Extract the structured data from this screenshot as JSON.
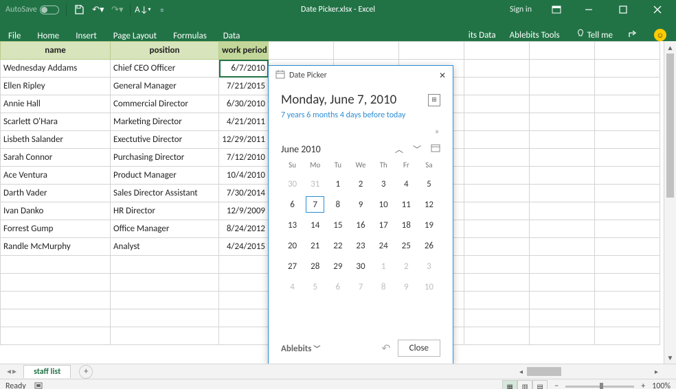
{
  "titlebar": {
    "autosave_label": "AutoSave",
    "autosave_state": "Off",
    "doc_title": "Date Picker.xlsx - Excel",
    "signin": "Sign in"
  },
  "ribbon": {
    "tabs": [
      "File",
      "Home",
      "Insert",
      "Page Layout",
      "Formulas",
      "Data"
    ],
    "right_tabs": [
      "its Data",
      "Ablebits Tools"
    ],
    "tellme": "Tell me"
  },
  "sheet": {
    "headers": [
      "name",
      "position",
      "work period"
    ],
    "rows": [
      {
        "name": "Wednesday Addams",
        "position": "Chief CEO Officer",
        "period": "6/7/2010"
      },
      {
        "name": "Ellen Ripley",
        "position": "General Manager",
        "period": "7/21/2015"
      },
      {
        "name": "Annie Hall",
        "position": "Commercial Director",
        "period": "6/30/2010"
      },
      {
        "name": "Scarlett O'Hara",
        "position": "Marketing Director",
        "period": "4/21/2011"
      },
      {
        "name": "Lisbeth Salander",
        "position": "Exectutive Director",
        "period": "12/29/2011"
      },
      {
        "name": "Sarah Connor",
        "position": "Purchasing Director",
        "period": "7/12/2010"
      },
      {
        "name": "Ace Ventura",
        "position": "Product Manager",
        "period": "10/4/2010"
      },
      {
        "name": "Darth Vader",
        "position": "Sales Director Assistant",
        "period": "7/30/2014"
      },
      {
        "name": "Ivan Danko",
        "position": "HR Director",
        "period": "12/9/2009"
      },
      {
        "name": "Forrest Gump",
        "position": "Office Manager",
        "period": "8/24/2012"
      },
      {
        "name": "Randle McMurphy",
        "position": "Analyst",
        "period": "4/24/2015"
      }
    ],
    "selected_row": 0,
    "tab_name": "staff list"
  },
  "picker": {
    "pane_title": "Date Picker",
    "big_date": "Monday, June 7, 2010",
    "relative": "7 years 6 months 4 days before today",
    "month_label": "June 2010",
    "dow": [
      "Su",
      "Mo",
      "Tu",
      "We",
      "Th",
      "Fr",
      "Sa"
    ],
    "grid": [
      {
        "d": "30",
        "m": true
      },
      {
        "d": "31",
        "m": true
      },
      {
        "d": "1"
      },
      {
        "d": "2"
      },
      {
        "d": "3"
      },
      {
        "d": "4"
      },
      {
        "d": "5"
      },
      {
        "d": "6"
      },
      {
        "d": "7",
        "sel": true
      },
      {
        "d": "8"
      },
      {
        "d": "9"
      },
      {
        "d": "10"
      },
      {
        "d": "11"
      },
      {
        "d": "12"
      },
      {
        "d": "13"
      },
      {
        "d": "14"
      },
      {
        "d": "15"
      },
      {
        "d": "16"
      },
      {
        "d": "17"
      },
      {
        "d": "18"
      },
      {
        "d": "19"
      },
      {
        "d": "20"
      },
      {
        "d": "21"
      },
      {
        "d": "22"
      },
      {
        "d": "23"
      },
      {
        "d": "24"
      },
      {
        "d": "25"
      },
      {
        "d": "26"
      },
      {
        "d": "27"
      },
      {
        "d": "28"
      },
      {
        "d": "29"
      },
      {
        "d": "30"
      },
      {
        "d": "1",
        "m": true
      },
      {
        "d": "2",
        "m": true
      },
      {
        "d": "3",
        "m": true
      },
      {
        "d": "4",
        "m": true
      },
      {
        "d": "5",
        "m": true
      },
      {
        "d": "6",
        "m": true
      },
      {
        "d": "7",
        "m": true
      },
      {
        "d": "8",
        "m": true
      },
      {
        "d": "9",
        "m": true
      },
      {
        "d": "10",
        "m": true
      }
    ],
    "brand": "Ablebits",
    "close_label": "Close"
  },
  "status": {
    "ready": "Ready",
    "zoom": "100%"
  }
}
